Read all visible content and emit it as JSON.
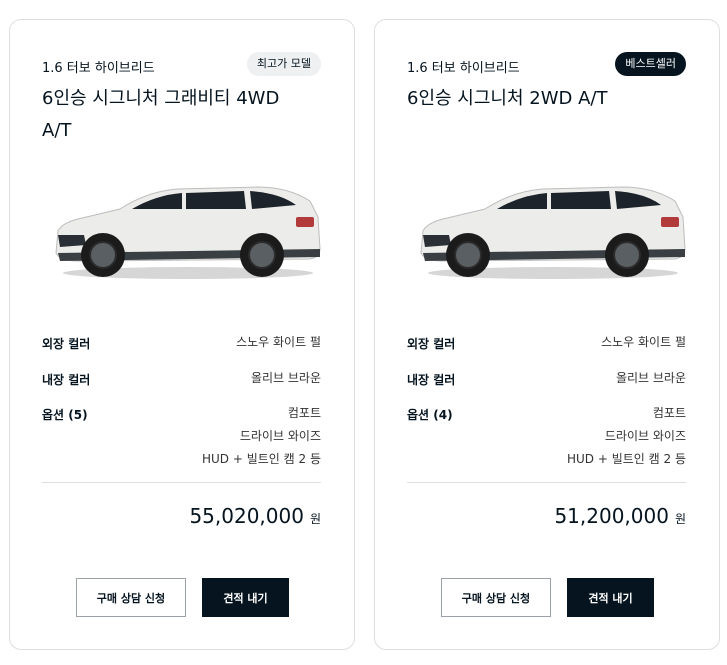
{
  "cards": [
    {
      "engine": "1.6 터보 하이브리드",
      "badge": "최고가 모델",
      "model": "6인승 시그니처 그래비티 4WD A/T",
      "specs": {
        "exterior_label": "외장 컬러",
        "exterior_value": "스노우 화이트 펄",
        "interior_label": "내장 컬러",
        "interior_value": "올리브 브라운",
        "options_label": "옵션 (5)",
        "options": [
          "컴포트",
          "드라이브 와이즈",
          "HUD + 빌트인 캠 2 등"
        ]
      },
      "price": "55,020,000",
      "currency": "원",
      "consult_button": "구매 상담 신청",
      "quote_button": "견적 내기"
    },
    {
      "engine": "1.6 터보 하이브리드",
      "badge": "베스트셀러",
      "model": "6인승 시그니처 2WD A/T",
      "specs": {
        "exterior_label": "외장 컬러",
        "exterior_value": "스노우 화이트 펄",
        "interior_label": "내장 컬러",
        "interior_value": "올리브 브라운",
        "options_label": "옵션 (4)",
        "options": [
          "컴포트",
          "드라이브 와이즈",
          "HUD + 빌트인 캠 2 등"
        ]
      },
      "price": "51,200,000",
      "currency": "원",
      "consult_button": "구매 상담 신청",
      "quote_button": "견적 내기"
    }
  ],
  "colors": {
    "brand_dark": "#05141f",
    "badge_light": "#eef0f2",
    "border": "#dcdfe2",
    "car_body": "#e9e9e7"
  }
}
